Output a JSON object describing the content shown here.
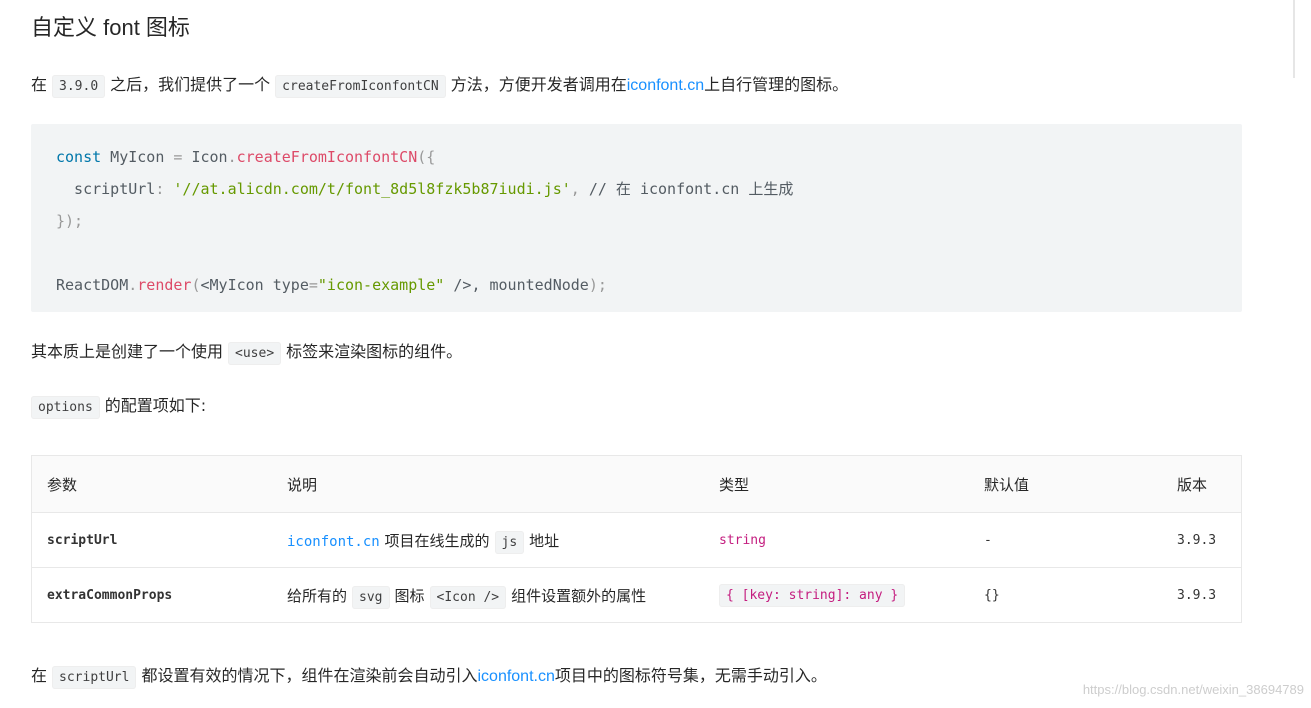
{
  "title": "自定义 font 图标",
  "intro": {
    "p1": "在",
    "version_code": "3.9.0",
    "p2": "之后，我们提供了一个",
    "method_code": "createFromIconfontCN",
    "p3": "方法，方便开发者调用在",
    "link": "iconfont.cn",
    "p4": "上自行管理的图标。"
  },
  "code": {
    "l1_const": "const",
    "l1_name": " MyIcon ",
    "l1_eq": "=",
    "l1_icon": " Icon",
    "l1_dot": ".",
    "l1_fn": "createFromIconfontCN",
    "l1_open": "({",
    "l2_key": "  scriptUrl",
    "l2_colon": ":",
    "l2_str": " '//at.alicdn.com/t/font_8d5l8fzk5b87iudi.js'",
    "l2_comma": ",",
    "l2_comment": " // 在 iconfont.cn 上生成",
    "l3": "});",
    "l5_obj": "ReactDOM",
    "l5_dot": ".",
    "l5_fn": "render",
    "l5_open": "(",
    "l5_tag_open": "<MyIcon",
    "l5_attr": " type",
    "l5_eq": "=",
    "l5_val": "\"icon-example\"",
    "l5_tag_close": " />",
    "l5_rest": ", mountedNode",
    "l5_end": ");"
  },
  "essence": {
    "p1": "其本质上是创建了一个使用",
    "code": "<use>",
    "p2": "标签来渲染图标的组件。"
  },
  "options_line": {
    "code": "options",
    "text": "的配置项如下:"
  },
  "table": {
    "headers": [
      "参数",
      "说明",
      "类型",
      "默认值",
      "版本"
    ],
    "rows": [
      {
        "param": "scriptUrl",
        "desc_link": "iconfont.cn",
        "desc_mid": "项目在线生成的",
        "desc_code": "js",
        "desc_end": "地址",
        "type": "string",
        "default": "-",
        "version": "3.9.3"
      },
      {
        "param": "extraCommonProps",
        "desc_start": "给所有的",
        "desc_code1": "svg",
        "desc_mid": "图标",
        "desc_code2": "<Icon />",
        "desc_end": "组件设置额外的属性",
        "type": "{ [key: string]: any }",
        "default": "{}",
        "version": "3.9.3"
      }
    ]
  },
  "footer": {
    "p1": "在",
    "code": "scriptUrl",
    "p2": "都设置有效的情况下，组件在渲染前会自动引入",
    "link": "iconfont.cn",
    "p3": "项目中的图标符号集，无需手动引入。"
  },
  "watermark": "https://blog.csdn.net/weixin_38694789"
}
